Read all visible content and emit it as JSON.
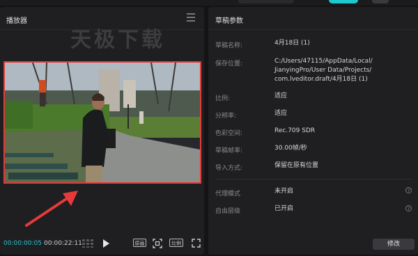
{
  "player": {
    "title": "播放器",
    "watermark": "天极下载",
    "time_current": "00:00:00:05",
    "time_total": "00:00:22:11",
    "original_label": "原画",
    "ratio_label": "比例"
  },
  "params": {
    "title": "草稿参数",
    "rows": [
      {
        "label": "草稿名称:",
        "value": "4月18日 (1)"
      },
      {
        "label": "保存位置:",
        "value_lines": [
          "C:/Users/47115/AppData/Local/",
          "JianyingPro/User Data/Projects/",
          "com.lveditor.draft/4月18日 (1)"
        ]
      },
      {
        "label": "比例:",
        "value": "适应"
      },
      {
        "label": "分辨率:",
        "value": "适应"
      },
      {
        "label": "色彩空间:",
        "value": "Rec.709 SDR"
      },
      {
        "label": "草稿帧率:",
        "value": "30.00帧/秒"
      },
      {
        "label": "导入方式:",
        "value": "保留在原有位置"
      }
    ],
    "proxy": {
      "label": "代理模式",
      "value": "未开启"
    },
    "freelayer": {
      "label": "自由层级",
      "value": "已开启"
    },
    "edit_label": "修改"
  },
  "colors": {
    "accent": "#27c4cc",
    "highlight": "#e63a3a"
  }
}
